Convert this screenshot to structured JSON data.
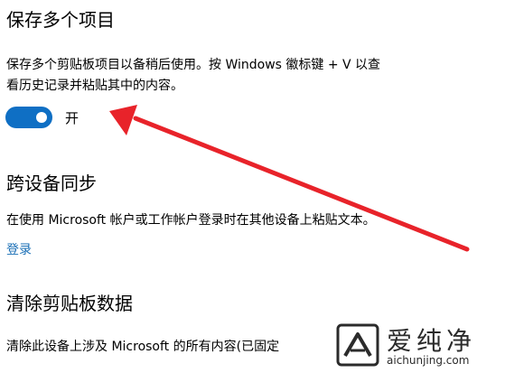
{
  "clipboard_history": {
    "title": "保存多个项目",
    "desc_line1": "保存多个剪贴板项目以备稍后使用。按 Windows 徽标键 + V 以查",
    "desc_line2": "看历史记录并粘贴其中的内容。",
    "toggle_state": "on",
    "toggle_label": "开"
  },
  "sync": {
    "title": "跨设备同步",
    "desc": "在使用 Microsoft 帐户或工作帐户登录时在其他设备上粘贴文本。",
    "signin_link": "登录"
  },
  "clear": {
    "title": "清除剪贴板数据",
    "desc": "清除此设备上涉及 Microsoft 的所有内容(已固定"
  },
  "annotation": {
    "arrow_color": "#e8232a",
    "arrow_target": "toggle"
  },
  "watermark": {
    "logo_icon": "aichunjing-logo-icon",
    "cn_text": "爱纯净",
    "url_text": "aichunjing.com"
  },
  "colors": {
    "accent": "#0f6fc4",
    "link": "#1a6fb6",
    "text": "#000000",
    "background": "#ffffff"
  }
}
